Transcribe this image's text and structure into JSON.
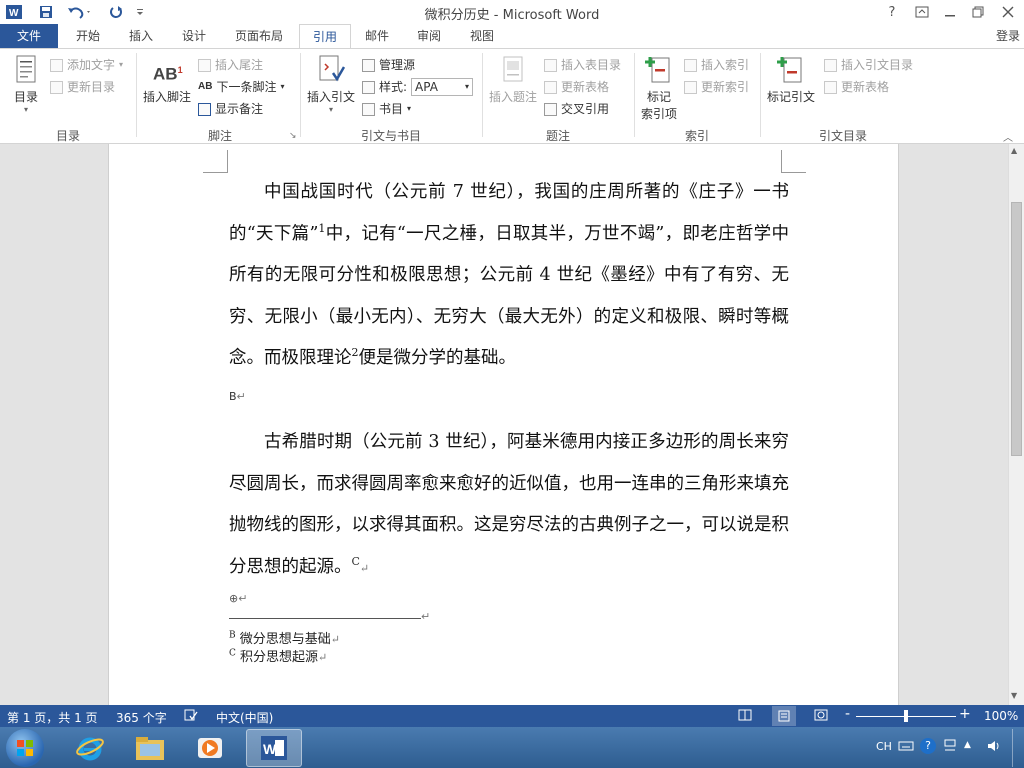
{
  "window": {
    "title": "微积分历史 - Microsoft Word",
    "help": "?",
    "login": "登录"
  },
  "tabs": [
    "文件",
    "开始",
    "插入",
    "设计",
    "页面布局",
    "引用",
    "邮件",
    "审阅",
    "视图"
  ],
  "ribbon": {
    "toc": {
      "button": "目录",
      "add_text": "添加文字",
      "update": "更新目录",
      "group": "目录"
    },
    "footnote": {
      "icon_text": "AB",
      "insert_footnote": "插入脚注",
      "insert_endnote": "插入尾注",
      "next_footnote": "下一条脚注",
      "show_notes": "显示备注",
      "group": "脚注"
    },
    "citation": {
      "insert_citation": "插入引文",
      "manage_sources": "管理源",
      "style_label": "样式:",
      "style_value": "APA",
      "bibliography": "书目",
      "group": "引文与书目"
    },
    "captions": {
      "insert_caption": "插入题注",
      "insert_table_of_figures": "插入表目录",
      "update_table": "更新表格",
      "cross_reference": "交叉引用",
      "group": "题注"
    },
    "index": {
      "mark_entry_line1": "标记",
      "mark_entry_line2": "索引项",
      "insert_index": "插入索引",
      "update_index": "更新索引",
      "group": "索引"
    },
    "authorities": {
      "mark_citation": "标记引文",
      "insert_toa": "插入引文目录",
      "update_table": "更新表格",
      "group": "引文目录"
    }
  },
  "document": {
    "para1_a": "中国战国时代（公元前 7 世纪），我国的庄周所著的《庄子》一书的“天下篇”",
    "para1_sup1": "1",
    "para1_b": "中，记有“一尺之棰，日取其半，万世不竭”，即老庄哲学中所有的无限可分性和极限思想；公元前 4 世纪《墨经》中有了有穷、无穷、无限小（最小无内）、无穷大（最大无外）的定义和极限、瞬时等概念。而极限理论",
    "para1_sup2": "2",
    "para1_c": "便是微分学的基础。",
    "note_mark_b": "B",
    "para2": "古希腊时期（公元前 3 世纪），阿基米德用内接正多边形的周长来穷尽圆周长，而求得圆周率愈来愈好的近似值，也用一连串的三角形来填充抛物线的图形，以求得其面积。这是穷尽法的古典例子之一，可以说是积分思想的起源。",
    "note_mark_c": "C",
    "footnotes": [
      {
        "mark": "B",
        "text": "微分思想与基础"
      },
      {
        "mark": "C",
        "text": "积分思想起源"
      }
    ]
  },
  "statusbar": {
    "page": "第 1 页，共 1 页",
    "words": "365 个字",
    "language": "中文(中国)",
    "zoom": "100%",
    "zoom_minus": "-",
    "zoom_plus": "+"
  },
  "taskbar": {
    "ime": "CH"
  },
  "colors": {
    "accent": "#2b579a",
    "paragraph_mark": "#777777"
  }
}
